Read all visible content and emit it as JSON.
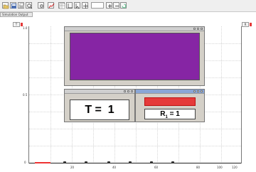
{
  "toolbar": {
    "buttons": [
      "open-icon",
      "save-icon",
      "print-icon",
      "zoom-icon",
      "settings-icon",
      "graph-icon",
      "table-icon",
      "axes-icon",
      "cursor-icon",
      "pan-icon",
      "zoom-in-icon",
      "zoom-out-icon",
      "refresh-icon",
      "help-icon"
    ]
  },
  "window_title": "Simulation Output",
  "corner_left_label": "T",
  "corner_right_label": "R",
  "y_ticks": [
    "1.0",
    "0.5",
    "0"
  ],
  "x_ticks": [
    "20",
    "40",
    "60",
    "80",
    "100",
    "120"
  ],
  "main_plot": {
    "baseline_color": "#222222",
    "trace_color": "#e33333"
  },
  "color_window": {
    "color": "#8625a4"
  },
  "t_window": {
    "label": "T",
    "equals": "=",
    "value": "1"
  },
  "r_window": {
    "label": "R",
    "subscript": "1",
    "equals": "=",
    "value": "1",
    "indicator_color": "#e53a3a"
  }
}
